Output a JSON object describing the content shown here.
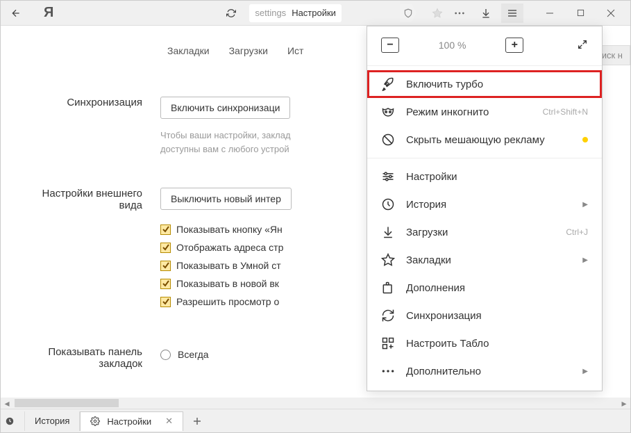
{
  "toolbar": {
    "addr_label": "settings",
    "addr_title": "Настройки"
  },
  "tabs": [
    "Закладки",
    "Загрузки",
    "Ист"
  ],
  "search_placeholder": "Поиск н",
  "sections": {
    "sync": {
      "label": "Синхронизация",
      "button": "Включить синхронизаци",
      "hint1": "Чтобы ваши настройки, заклад",
      "hint2": "доступны вам с любого устрой"
    },
    "appearance": {
      "label1": "Настройки внешнего",
      "label2": "вида",
      "button": "Выключить новый интер",
      "checks": [
        "Показывать кнопку «Ян",
        "Отображать адреса стр",
        "Показывать в Умной ст",
        "Показывать в новой вк",
        "Разрешить просмотр о"
      ]
    },
    "bookmarks_panel": {
      "label1": "Показывать панель",
      "label2": "закладок",
      "option": "Всегда"
    }
  },
  "menu": {
    "zoom": "100 %",
    "items": [
      {
        "label": "Включить турбо",
        "shortcut": "",
        "submenu": false,
        "highlighted": true,
        "icon": "rocket"
      },
      {
        "label": "Режим инкогнито",
        "shortcut": "Ctrl+Shift+N",
        "submenu": false,
        "icon": "mask"
      },
      {
        "label": "Скрыть мешающую рекламу",
        "shortcut": "",
        "submenu": false,
        "dot": true,
        "icon": "noads"
      },
      {
        "sep": true
      },
      {
        "label": "Настройки",
        "icon": "sliders"
      },
      {
        "label": "История",
        "submenu": true,
        "icon": "history"
      },
      {
        "label": "Загрузки",
        "shortcut": "Ctrl+J",
        "icon": "download"
      },
      {
        "label": "Закладки",
        "submenu": true,
        "icon": "star"
      },
      {
        "label": "Дополнения",
        "icon": "puzzle"
      },
      {
        "label": "Синхронизация",
        "icon": "refresh"
      },
      {
        "label": "Настроить Табло",
        "icon": "grid"
      },
      {
        "label": "Дополнительно",
        "submenu": true,
        "icon": "more"
      }
    ]
  },
  "bottom": {
    "history": "История",
    "settings": "Настройки"
  }
}
